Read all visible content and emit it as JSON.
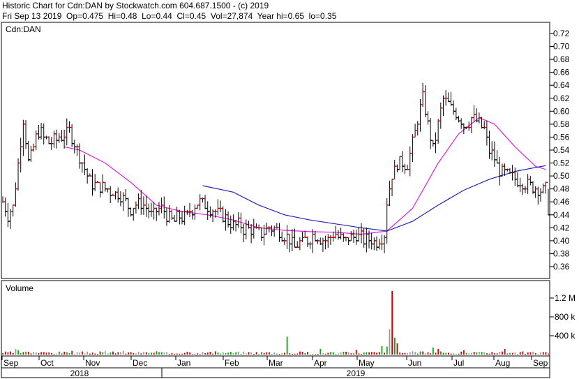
{
  "header": {
    "line1": "Historic Chart for Cdn:DAN by Stockwatch.com 604.687.1500 - (c) 2019",
    "line2": "Fri Sep 13 2019  Op=0.475  Hi=0.48  Lo=0.44  Cl=0.45  Vol=27,874  Year hi=0.65  lo=0.35"
  },
  "colors": {
    "up": "#cc0000",
    "down": "#000000",
    "ma_short": "#dd22dd",
    "ma_long": "#2222bb",
    "vol_up": "#cc0000",
    "vol_down": "#00aa00",
    "vol_neutral": "#999999"
  },
  "chart_data": [
    {
      "type": "line",
      "title": "Cdn:DAN",
      "xlabel": "",
      "ylabel": "",
      "ylim": [
        0.34,
        0.73
      ],
      "y_ticks": [
        "0.72",
        "0.70",
        "0.68",
        "0.66",
        "0.64",
        "0.62",
        "0.60",
        "0.58",
        "0.56",
        "0.54",
        "0.52",
        "0.50",
        "0.48",
        "0.46",
        "0.44",
        "0.42",
        "0.40",
        "0.38",
        "0.36"
      ],
      "x_ticks": [
        "Sep",
        "Oct",
        "Nov",
        "Dec",
        "Jan",
        "Feb",
        "Mar",
        "Apr",
        "May",
        "Jun",
        "Jul",
        "Aug",
        "Sep"
      ],
      "year_labels": [
        "2018",
        "2019"
      ],
      "grid": false,
      "price_series": {
        "name": "",
        "anchors": [
          [
            0,
            0.46
          ],
          [
            2,
            0.44
          ],
          [
            4,
            0.45
          ],
          [
            6,
            0.52
          ],
          [
            8,
            0.59
          ],
          [
            10,
            0.52
          ],
          [
            14,
            0.57
          ],
          [
            18,
            0.55
          ],
          [
            22,
            0.56
          ],
          [
            26,
            0.57
          ],
          [
            30,
            0.53
          ],
          [
            34,
            0.49
          ],
          [
            40,
            0.48
          ],
          [
            46,
            0.47
          ],
          [
            50,
            0.45
          ],
          [
            54,
            0.46
          ],
          [
            58,
            0.44
          ],
          [
            62,
            0.45
          ],
          [
            66,
            0.43
          ],
          [
            72,
            0.44
          ],
          [
            76,
            0.46
          ],
          [
            82,
            0.45
          ],
          [
            88,
            0.43
          ],
          [
            94,
            0.42
          ],
          [
            100,
            0.41
          ],
          [
            104,
            0.42
          ],
          [
            110,
            0.41
          ],
          [
            114,
            0.39
          ],
          [
            118,
            0.4
          ],
          [
            122,
            0.41
          ],
          [
            126,
            0.4
          ],
          [
            130,
            0.41
          ],
          [
            134,
            0.4
          ],
          [
            138,
            0.41
          ],
          [
            142,
            0.4
          ],
          [
            146,
            0.4
          ],
          [
            149,
            0.41
          ],
          [
            150,
            0.46
          ],
          [
            152,
            0.5
          ],
          [
            154,
            0.52
          ],
          [
            158,
            0.52
          ],
          [
            160,
            0.55
          ],
          [
            164,
            0.62
          ],
          [
            168,
            0.54
          ],
          [
            172,
            0.62
          ],
          [
            176,
            0.6
          ],
          [
            180,
            0.58
          ],
          [
            184,
            0.59
          ],
          [
            188,
            0.57
          ],
          [
            190,
            0.54
          ],
          [
            194,
            0.51
          ],
          [
            198,
            0.5
          ],
          [
            204,
            0.49
          ],
          [
            208,
            0.48
          ],
          [
            212,
            0.48
          ],
          [
            213,
            0.45
          ]
        ],
        "n": 214,
        "x_start_date": "Sep 2018",
        "last": {
          "open": 0.475,
          "high": 0.48,
          "low": 0.44,
          "close": 0.45
        }
      },
      "moving_averages": [
        {
          "name": "",
          "points": [
            [
              24,
              0.545
            ],
            [
              30,
              0.54
            ],
            [
              40,
              0.52
            ],
            [
              50,
              0.49
            ],
            [
              60,
              0.455
            ],
            [
              70,
              0.445
            ],
            [
              80,
              0.44
            ],
            [
              90,
              0.432
            ],
            [
              100,
              0.42
            ],
            [
              110,
              0.416
            ],
            [
              120,
              0.414
            ],
            [
              130,
              0.413
            ],
            [
              140,
              0.41
            ],
            [
              150,
              0.415
            ],
            [
              160,
              0.45
            ],
            [
              170,
              0.52
            ],
            [
              178,
              0.565
            ],
            [
              186,
              0.59
            ],
            [
              192,
              0.58
            ],
            [
              200,
              0.545
            ],
            [
              208,
              0.515
            ],
            [
              212,
              0.51
            ]
          ]
        },
        {
          "name": "",
          "points": [
            [
              78,
              0.485
            ],
            [
              90,
              0.475
            ],
            [
              100,
              0.455
            ],
            [
              110,
              0.44
            ],
            [
              120,
              0.432
            ],
            [
              130,
              0.426
            ],
            [
              140,
              0.42
            ],
            [
              150,
              0.415
            ],
            [
              160,
              0.43
            ],
            [
              170,
              0.455
            ],
            [
              180,
              0.478
            ],
            [
              190,
              0.495
            ],
            [
              200,
              0.507
            ],
            [
              208,
              0.513
            ],
            [
              212,
              0.516
            ]
          ]
        }
      ]
    },
    {
      "type": "bar",
      "title": "Volume",
      "ylabel": "",
      "ylim": [
        0,
        1400000
      ],
      "y_ticks": [
        "1.2 M",
        "800 k",
        "400 k"
      ],
      "base_volume": 40000,
      "spikes": [
        [
          5,
          120000
        ],
        [
          6,
          90000
        ],
        [
          12,
          60000
        ],
        [
          27,
          80000
        ],
        [
          40,
          70000
        ],
        [
          47,
          80000
        ],
        [
          60,
          70000
        ],
        [
          72,
          60000
        ],
        [
          111,
          380000
        ],
        [
          124,
          120000
        ],
        [
          133,
          60000
        ],
        [
          138,
          100000
        ],
        [
          148,
          180000
        ],
        [
          150,
          170000
        ],
        [
          151,
          540000
        ],
        [
          152,
          1350000
        ],
        [
          153,
          360000
        ],
        [
          154,
          240000
        ],
        [
          160,
          70000
        ],
        [
          168,
          150000
        ],
        [
          170,
          120000
        ],
        [
          180,
          90000
        ],
        [
          186,
          60000
        ],
        [
          196,
          120000
        ],
        [
          210,
          50000
        ]
      ]
    }
  ]
}
